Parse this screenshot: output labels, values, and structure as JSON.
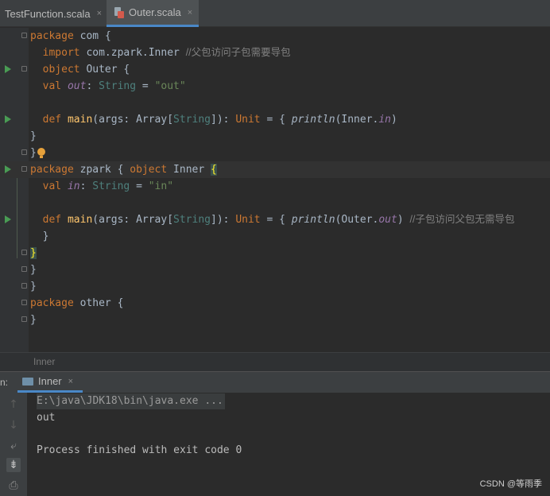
{
  "tabs": [
    {
      "label": "TestFunction.scala",
      "close": "×"
    },
    {
      "label": "Outer.scala",
      "close": "×"
    }
  ],
  "code": {
    "l1": {
      "kw": "package",
      "name": " com ",
      "brace": "{"
    },
    "l2": {
      "kw": "import",
      "path": " com.zpark.Inner ",
      "comment": "//父包访问子包需要导包"
    },
    "l3": {
      "kw": "object",
      "name": " Outer ",
      "brace": "{"
    },
    "l4": {
      "kw": "val",
      "field": "out",
      "colon": ": ",
      "type": "String",
      "eq": " = ",
      "str": "\"out\""
    },
    "l6": {
      "kw": "def",
      "fn": "main",
      "p1": "(args: Array[",
      "type": "String",
      "p2": "]): ",
      "unit": "Unit",
      "p3": " = { ",
      "println": "println",
      "p4": "(Inner.",
      "field": "in",
      "p5": ")"
    },
    "l7": {
      "text": "}"
    },
    "l8": {
      "text": "}"
    },
    "l9": {
      "kw": "package",
      "name": " zpark { ",
      "kw2": "object",
      "name2": " Inner ",
      "brace": "{"
    },
    "l10": {
      "kw": "val",
      "field": "in",
      "colon": ": ",
      "type": "String",
      "eq": " = ",
      "str": "\"in\""
    },
    "l12": {
      "kw": "def",
      "fn": "main",
      "p1": "(args: Array[",
      "type": "String",
      "p2": "]): ",
      "unit": "Unit",
      "p3": " = { ",
      "println": "println",
      "p4": "(Outer.",
      "field": "out",
      "p5": ") ",
      "comment": "//子包访问父包无需导包"
    },
    "l13": {
      "text": "}"
    },
    "l14": {
      "text": "}"
    },
    "l15": {
      "text": "}"
    },
    "l16": {
      "text": "}"
    },
    "l17": {
      "kw": "package",
      "name": " other ",
      "brace": "{"
    },
    "l18": {
      "text": "}"
    }
  },
  "breadcrumb": "Inner",
  "run": {
    "label": "n:",
    "tab_label": "Inner",
    "tab_close": "×",
    "console": {
      "command": "E:\\java\\JDK18\\bin\\java.exe ...",
      "output": "out",
      "finish": "Process finished with exit code 0"
    }
  },
  "icons": {
    "run": "run-gutter-icon",
    "fold": "fold-marker-icon",
    "intention": "lightbulb-icon"
  },
  "watermark": "CSDN @等雨季"
}
